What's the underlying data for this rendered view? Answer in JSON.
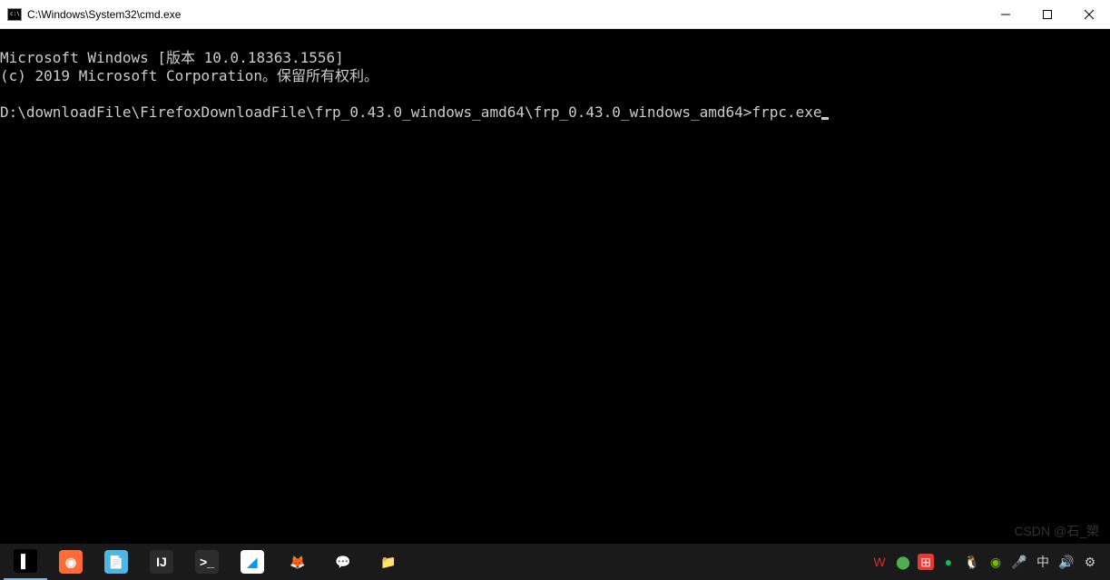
{
  "window": {
    "title": "C:\\Windows\\System32\\cmd.exe"
  },
  "terminal": {
    "line1": "Microsoft Windows [版本 10.0.18363.1556]",
    "line2": "(c) 2019 Microsoft Corporation。保留所有权利。",
    "prompt": "D:\\downloadFile\\FirefoxDownloadFile\\frp_0.43.0_windows_amd64\\frp_0.43.0_windows_amd64>",
    "command": "frpc.exe"
  },
  "taskbar": {
    "apps": [
      {
        "name": "cmd",
        "bg": "#000",
        "fg": "#fff",
        "glyph": "▌"
      },
      {
        "name": "postman",
        "bg": "#ff6c37",
        "fg": "#fff",
        "glyph": "◉"
      },
      {
        "name": "notepad",
        "bg": "#4db6e2",
        "fg": "#fff",
        "glyph": "📄"
      },
      {
        "name": "intellij",
        "bg": "#2b2b2b",
        "fg": "#fff",
        "glyph": "IJ"
      },
      {
        "name": "terminal2",
        "bg": "#2d2d2d",
        "fg": "#fff",
        "glyph": ">_"
      },
      {
        "name": "todesk",
        "bg": "#fff",
        "fg": "#0099ff",
        "glyph": "◢"
      },
      {
        "name": "firefox",
        "bg": "transparent",
        "fg": "#ff9500",
        "glyph": "🦊"
      },
      {
        "name": "wechat",
        "bg": "transparent",
        "fg": "#07c160",
        "glyph": "💬"
      },
      {
        "name": "explorer",
        "bg": "transparent",
        "fg": "#ffb900",
        "glyph": "📁"
      }
    ],
    "tray": [
      {
        "name": "wps",
        "fg": "#d92b2b",
        "glyph": "W"
      },
      {
        "name": "security",
        "fg": "#4caf50",
        "glyph": "⬤"
      },
      {
        "name": "app-red",
        "fg": "#fff",
        "bg": "#e53935",
        "glyph": "⊞"
      },
      {
        "name": "wechat-tray",
        "fg": "#07c160",
        "glyph": "●"
      },
      {
        "name": "qq",
        "fg": "#12b7f5",
        "glyph": "🐧"
      },
      {
        "name": "nvidia",
        "fg": "#76b900",
        "glyph": "◉"
      },
      {
        "name": "mic",
        "fg": "#ccc",
        "glyph": "🎤"
      },
      {
        "name": "ime",
        "fg": "#ccc",
        "glyph": "中"
      },
      {
        "name": "volume",
        "fg": "#ccc",
        "glyph": "🔊"
      },
      {
        "name": "network",
        "fg": "#ccc",
        "glyph": "⚙"
      }
    ]
  },
  "watermark": "CSDN @石_槊"
}
